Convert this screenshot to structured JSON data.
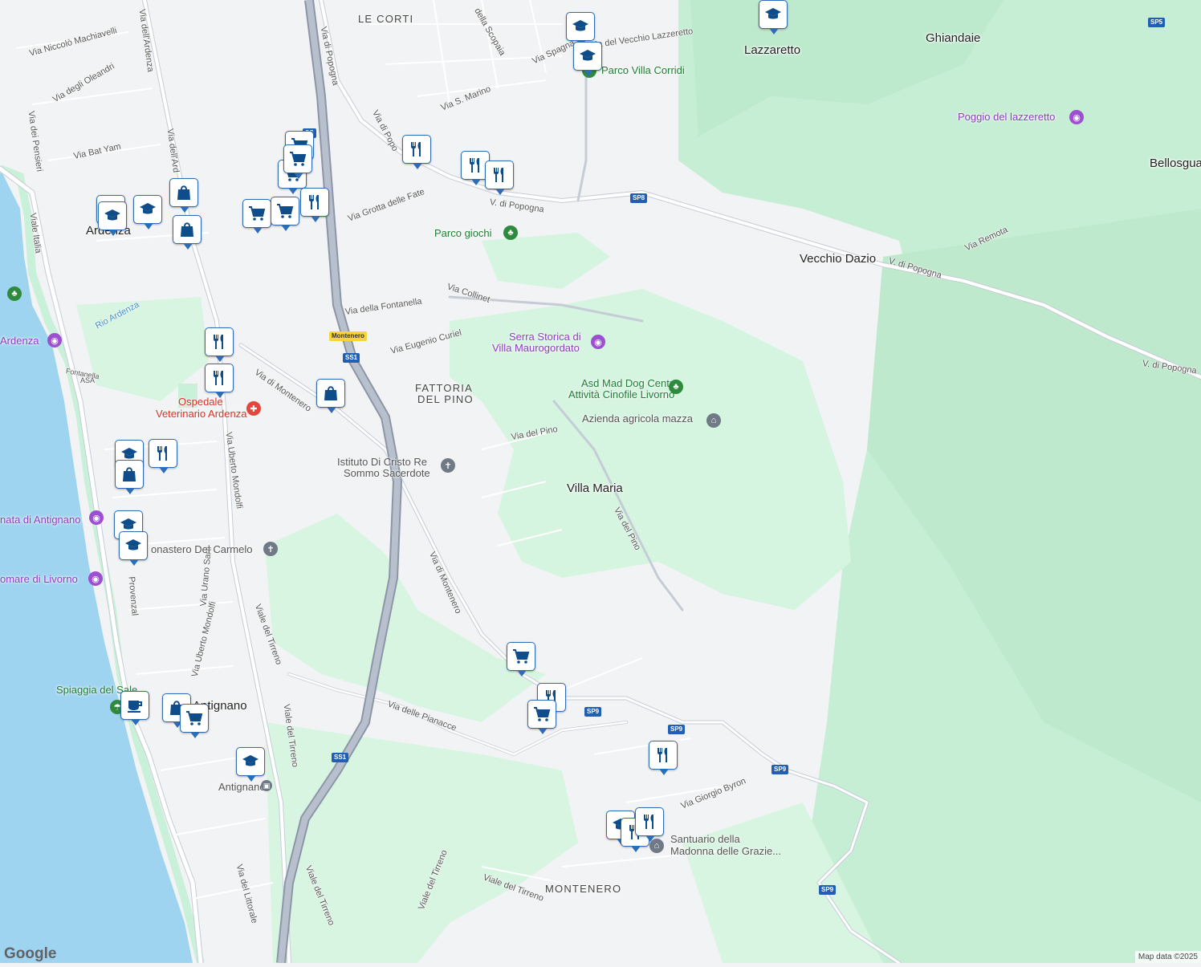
{
  "map": {
    "places": [
      {
        "id": "le-corti",
        "text": "LE CORTI"
      },
      {
        "id": "lazzaretto",
        "text": "Lazzaretto"
      },
      {
        "id": "ghiandaie",
        "text": "Ghiandaie"
      },
      {
        "id": "bellosgua",
        "text": "Bellosgua"
      },
      {
        "id": "vecchio-dazio",
        "text": "Vecchio Dazio"
      },
      {
        "id": "ardenza",
        "text": "Ardenza"
      },
      {
        "id": "fattoria-1",
        "text": "FATTORIA"
      },
      {
        "id": "fattoria-2",
        "text": "DEL PINO"
      },
      {
        "id": "villa-maria",
        "text": "Villa Maria"
      },
      {
        "id": "antignano",
        "text": "Antignano"
      },
      {
        "id": "montenero",
        "text": "MONTENERO"
      }
    ],
    "roads": [
      {
        "id": "r1",
        "text": "Via Niccolò Machiavelli"
      },
      {
        "id": "r2",
        "text": "Via dell'Ardenza"
      },
      {
        "id": "r3",
        "text": "Via degli Oleandri"
      },
      {
        "id": "r4",
        "text": "Via dei Pensieri"
      },
      {
        "id": "r5",
        "text": "Via Bat Yam"
      },
      {
        "id": "r6",
        "text": "Via dell'Ard"
      },
      {
        "id": "r7",
        "text": "Viale Italia"
      },
      {
        "id": "r8",
        "text": "Via di Popogna"
      },
      {
        "id": "r9",
        "text": "Via di Popo"
      },
      {
        "id": "r10",
        "text": "Via S. Marino"
      },
      {
        "id": "r11",
        "text": "Via Spagna"
      },
      {
        "id": "r12",
        "text": "Via del Vecchio Lazzeretto"
      },
      {
        "id": "r13",
        "text": "della Scopaia"
      },
      {
        "id": "r14",
        "text": "Via Grotta delle Fate"
      },
      {
        "id": "r15",
        "text": "V. di Popogna"
      },
      {
        "id": "r16",
        "text": "V. di Popogna"
      },
      {
        "id": "r17",
        "text": "V. di Popogna"
      },
      {
        "id": "r18",
        "text": "Via Remota"
      },
      {
        "id": "r19",
        "text": "Via Collinet"
      },
      {
        "id": "r20",
        "text": "Via della Fontanella"
      },
      {
        "id": "r21",
        "text": "Rio Ardenza"
      },
      {
        "id": "r22",
        "text": "Via Eugenio Curiel"
      },
      {
        "id": "r23",
        "text": "Via di Montenero"
      },
      {
        "id": "r24",
        "text": "Via del Pino"
      },
      {
        "id": "r25",
        "text": "Via del Pino"
      },
      {
        "id": "r26",
        "text": "Via Uberto Mondolfi"
      },
      {
        "id": "r27",
        "text": "Via Uberto Mondolfi"
      },
      {
        "id": "r28",
        "text": "Via Urano Sarti"
      },
      {
        "id": "r29",
        "text": "Via di Montenero"
      },
      {
        "id": "r30",
        "text": "Viale del Tirreno"
      },
      {
        "id": "r31",
        "text": "Viale del Tirreno"
      },
      {
        "id": "r32",
        "text": "Via delle Pianacce"
      },
      {
        "id": "r33",
        "text": "Via Giorgio Byron"
      },
      {
        "id": "r34",
        "text": "Viale del Tirreno"
      },
      {
        "id": "r35",
        "text": "Viale del Tirreno"
      },
      {
        "id": "r36",
        "text": "Viale del Tirreno"
      },
      {
        "id": "r37",
        "text": "Via del Littorale"
      },
      {
        "id": "r38",
        "text": "Provenzal"
      },
      {
        "id": "r39",
        "text": "Fontanella"
      },
      {
        "id": "r40",
        "text": "ASA"
      }
    ],
    "shields": [
      {
        "id": "s1",
        "text": "SP5"
      },
      {
        "id": "s2",
        "text": "SP8"
      },
      {
        "id": "s3",
        "text": "SS1"
      },
      {
        "id": "s4",
        "text": "Montenero"
      },
      {
        "id": "s5",
        "text": "SS1"
      },
      {
        "id": "s6",
        "text": "SP9"
      },
      {
        "id": "s7",
        "text": "SP9"
      },
      {
        "id": "s8",
        "text": "SP9"
      },
      {
        "id": "s9",
        "text": "SP9"
      },
      {
        "id": "s10",
        "text": "SS"
      }
    ],
    "pois": [
      {
        "id": "parco-villa-corridi",
        "text": "Parco Villa Corridi"
      },
      {
        "id": "poggio",
        "text": "Poggio del lazzeretto"
      },
      {
        "id": "parco-giochi",
        "text": "Parco giochi"
      },
      {
        "id": "serra-1",
        "text": "Serra Storica di"
      },
      {
        "id": "serra-2",
        "text": "Villa Maurogordato"
      },
      {
        "id": "asd-1",
        "text": "Asd Mad Dog Centro"
      },
      {
        "id": "asd-2",
        "text": "Attività Cinofile Livorno"
      },
      {
        "id": "azienda",
        "text": "Azienda agricola mazza"
      },
      {
        "id": "ardenza-poi",
        "text": "Ardenza"
      },
      {
        "id": "ospedale-1",
        "text": "Ospedale"
      },
      {
        "id": "ospedale-2",
        "text": "Veterinario Ardenza"
      },
      {
        "id": "istituto-1",
        "text": "Istituto Di Cristo Re"
      },
      {
        "id": "istituto-2",
        "text": "Sommo Sacerdote"
      },
      {
        "id": "antignano-poi",
        "text": "nata di Antignano"
      },
      {
        "id": "monastero",
        "text": "onastero Del Carmelo"
      },
      {
        "id": "lungomare",
        "text": "omare di Livorno"
      },
      {
        "id": "spiaggia",
        "text": "Spiaggia del Sale"
      },
      {
        "id": "antignano-station",
        "text": "Antignano"
      },
      {
        "id": "santuario-1",
        "text": "Santuario della"
      },
      {
        "id": "santuario-2",
        "text": "Madonna delle Grazie..."
      }
    ],
    "markers": [
      {
        "icon": "school-icon"
      },
      {
        "icon": "school-icon"
      },
      {
        "icon": "school-icon"
      },
      {
        "icon": "restaurant-icon"
      },
      {
        "icon": "restaurant-icon"
      },
      {
        "icon": "restaurant-icon"
      },
      {
        "icon": "shopping-cart-icon"
      },
      {
        "icon": "shopping-cart-icon"
      },
      {
        "icon": "shopping-cart-icon"
      },
      {
        "icon": "shopping-cart-icon"
      },
      {
        "icon": "shopping-cart-icon"
      },
      {
        "icon": "restaurant-icon"
      },
      {
        "icon": "school-icon"
      },
      {
        "icon": "school-icon"
      },
      {
        "icon": "school-icon"
      },
      {
        "icon": "shopping-bag-icon"
      },
      {
        "icon": "shopping-bag-icon"
      },
      {
        "icon": "restaurant-icon"
      },
      {
        "icon": "restaurant-icon"
      },
      {
        "icon": "shopping-bag-icon"
      },
      {
        "icon": "school-icon"
      },
      {
        "icon": "restaurant-icon"
      },
      {
        "icon": "shopping-bag-icon"
      },
      {
        "icon": "school-icon"
      },
      {
        "icon": "school-icon"
      },
      {
        "icon": "shopping-cart-icon"
      },
      {
        "icon": "restaurant-icon"
      },
      {
        "icon": "shopping-cart-icon"
      },
      {
        "icon": "coffee-icon"
      },
      {
        "icon": "shopping-bag-icon"
      },
      {
        "icon": "shopping-cart-icon"
      },
      {
        "icon": "school-icon"
      },
      {
        "icon": "restaurant-icon"
      },
      {
        "icon": "school-icon"
      },
      {
        "icon": "restaurant-icon"
      },
      {
        "icon": "restaurant-icon"
      }
    ],
    "colors": {
      "land": "#f2f3f4",
      "park": "#c9f0d8",
      "sea": "#9fd4f0",
      "road": "#ffffff",
      "highway": "#9aa4b4",
      "marker": "#2d6db5"
    }
  },
  "google_logo": "Google",
  "attribution": "Map data ©2025"
}
